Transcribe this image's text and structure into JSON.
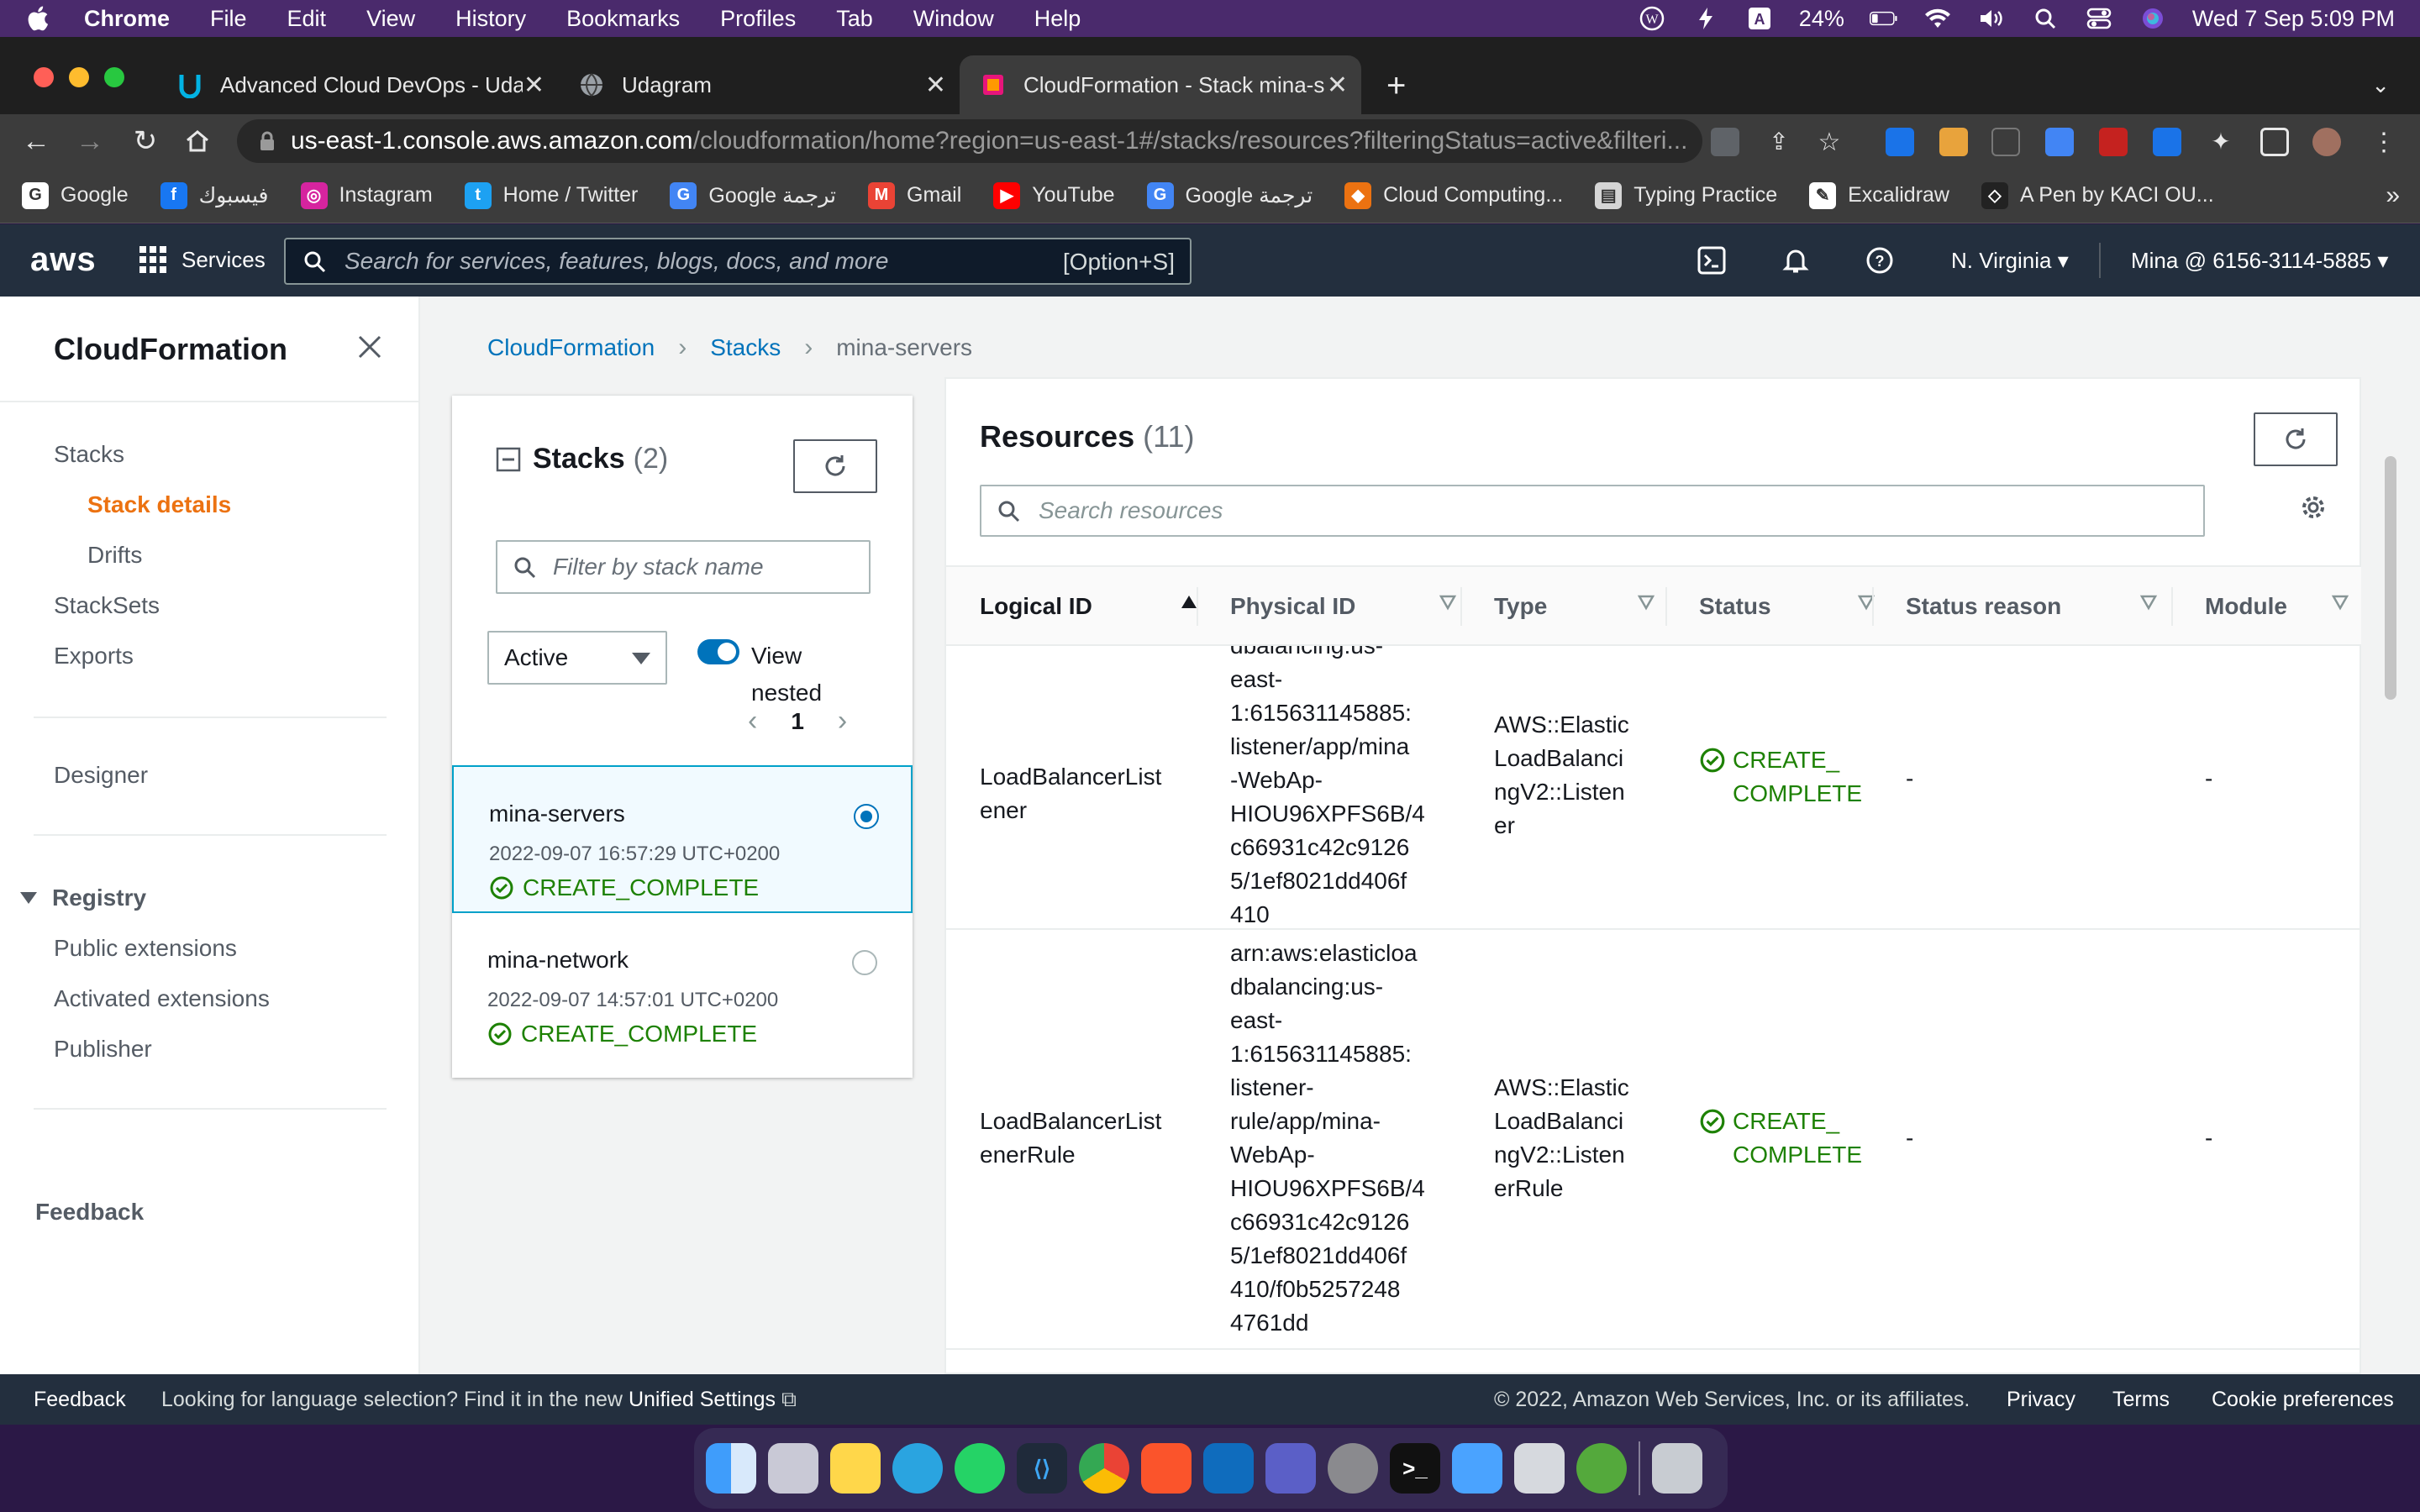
{
  "menubar": {
    "app": "Chrome",
    "items": [
      "File",
      "Edit",
      "View",
      "History",
      "Bookmarks",
      "Profiles",
      "Tab",
      "Window",
      "Help"
    ],
    "battery": "24%",
    "datetime": "Wed 7 Sep  5:09 PM"
  },
  "tabs": [
    {
      "title": "Advanced Cloud DevOps - Uda"
    },
    {
      "title": "Udagram"
    },
    {
      "title": "CloudFormation - Stack mina-s"
    }
  ],
  "address": {
    "host": "us-east-1.console.aws.amazon.com",
    "path": "/cloudformation/home?region=us-east-1#/stacks/resources?filteringStatus=active&filteri..."
  },
  "bookmarks": [
    {
      "label": "Google",
      "color": "#ffffff",
      "glyph": "G"
    },
    {
      "label": "فيسبوك",
      "color": "#1877f2",
      "glyph": "f"
    },
    {
      "label": "Instagram",
      "color": "#d6249f",
      "glyph": "◎"
    },
    {
      "label": "Home / Twitter",
      "color": "#1da1f2",
      "glyph": "t"
    },
    {
      "label": "Google ترجمة",
      "color": "#4285f4",
      "glyph": "G"
    },
    {
      "label": "Gmail",
      "color": "#ea4335",
      "glyph": "M"
    },
    {
      "label": "YouTube",
      "color": "#ff0000",
      "glyph": "▶"
    },
    {
      "label": "Google ترجمة",
      "color": "#4285f4",
      "glyph": "G"
    },
    {
      "label": "Cloud Computing...",
      "color": "#ec7211",
      "glyph": "◆"
    },
    {
      "label": "Typing Practice",
      "color": "#d5d5d5",
      "glyph": "▤"
    },
    {
      "label": "Excalidraw",
      "color": "#ffffff",
      "glyph": "✎"
    },
    {
      "label": "A Pen by KACI OU...",
      "color": "#222222",
      "glyph": "◇"
    }
  ],
  "aws": {
    "logo": "aws",
    "services": "Services",
    "search_placeholder": "Search for services, features, blogs, docs, and more",
    "search_shortcut": "[Option+S]",
    "region": "N. Virginia",
    "account": "Mina @ 6156-3114-5885"
  },
  "sidenav": {
    "title": "CloudFormation",
    "stacks": "Stacks",
    "stack_details": "Stack details",
    "drifts": "Drifts",
    "stacksets": "StackSets",
    "exports": "Exports",
    "designer": "Designer",
    "registry": "Registry",
    "public_extensions": "Public extensions",
    "activated_extensions": "Activated extensions",
    "publisher": "Publisher",
    "feedback": "Feedback"
  },
  "breadcrumb": [
    "CloudFormation",
    "Stacks",
    "mina-servers"
  ],
  "stacks_panel": {
    "title": "Stacks",
    "count": "(2)",
    "filter_placeholder": "Filter by stack name",
    "status_filter": "Active",
    "view_nested": "View nested",
    "page": "1",
    "items": [
      {
        "name": "mina-servers",
        "date": "2022-09-07 16:57:29 UTC+0200",
        "status": "CREATE_COMPLETE",
        "selected": true
      },
      {
        "name": "mina-network",
        "date": "2022-09-07 14:57:01 UTC+0200",
        "status": "CREATE_COMPLETE",
        "selected": false
      }
    ]
  },
  "resources": {
    "title": "Resources",
    "count": "(11)",
    "search_placeholder": "Search resources",
    "columns": [
      "Logical ID",
      "Physical ID",
      "Type",
      "Status",
      "Status reason",
      "Module"
    ],
    "rows": [
      {
        "logical_id": [
          "LoadBalancerList",
          "ener"
        ],
        "physical_id": [
          "dbalancing:us-",
          "east-",
          "1:615631145885:",
          "listener/app/mina",
          "-WebAp-",
          "HIOU96XPFS6B/4",
          "c66931c42c9126",
          "5/1ef8021dd406f",
          "410"
        ],
        "type": [
          "AWS::Elastic",
          "LoadBalanci",
          "ngV2::Listen",
          "er"
        ],
        "status": [
          "CREATE_",
          "COMPLETE"
        ],
        "status_reason": "-",
        "module": "-"
      },
      {
        "logical_id": [
          "LoadBalancerList",
          "enerRule"
        ],
        "physical_id": [
          "arn:aws:elasticloa",
          "dbalancing:us-",
          "east-",
          "1:615631145885:",
          "listener-",
          "rule/app/mina-",
          "WebAp-",
          "HIOU96XPFS6B/4",
          "c66931c42c9126",
          "5/1ef8021dd406f",
          "410/f0b5257248",
          "4761dd"
        ],
        "type": [
          "AWS::Elastic",
          "LoadBalanci",
          "ngV2::Listen",
          "erRule"
        ],
        "status": [
          "CREATE_",
          "COMPLETE"
        ],
        "status_reason": "-",
        "module": "-"
      }
    ]
  },
  "footer": {
    "feedback": "Feedback",
    "language_text": "Looking for language selection? Find it in the new",
    "unified_settings": "Unified Settings",
    "copyright": "© 2022, Amazon Web Services, Inc. or its affiliates.",
    "privacy": "Privacy",
    "terms": "Terms",
    "cookie": "Cookie preferences"
  },
  "colors": {
    "aws_orange": "#ec7211",
    "link_blue": "#0073bb",
    "success_green": "#1d8102",
    "aws_navy": "#232f3e"
  }
}
